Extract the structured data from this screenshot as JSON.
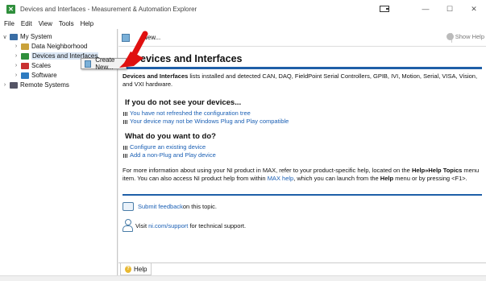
{
  "window": {
    "title": "Devices and Interfaces - Measurement & Automation Explorer",
    "app_icon_glyph": "✕",
    "controls": [
      "restore-icon",
      "minimize",
      "maximize",
      "close"
    ]
  },
  "menubar": [
    "File",
    "Edit",
    "View",
    "Tools",
    "Help"
  ],
  "tree": {
    "items": [
      {
        "label": "My System",
        "chevron": "∨",
        "icon": "computer-icon"
      },
      {
        "label": "Data Neighborhood",
        "chevron": "›",
        "icon": "data-neighborhood-icon"
      },
      {
        "label": "Devices and Interfaces",
        "chevron": "›",
        "icon": "devices-icon"
      },
      {
        "label": "Scales",
        "chevron": "›",
        "icon": "scales-icon"
      },
      {
        "label": "Software",
        "chevron": "›",
        "icon": "software-icon"
      },
      {
        "label": "Remote Systems",
        "chevron": "›",
        "icon": "remote-systems-icon"
      }
    ]
  },
  "context_menu": {
    "label": "Create New..."
  },
  "toolbar": {
    "new_label": "New...",
    "show_help_label": "Show Help"
  },
  "content": {
    "heading": "Devices and Interfaces",
    "intro_bold": "Devices and Interfaces",
    "intro_rest": " lists installed and detected CAN, DAQ, FieldPoint Serial Controllers, GPIB, IVI, Motion, Serial, VISA, Vision, and VXI hardware.",
    "section1_title": "If you do not see your devices...",
    "section1_links": [
      "You have not refreshed the configuration tree",
      "Your device may not be Windows Plug and Play compatible"
    ],
    "section2_title": "What do you want to do?",
    "section2_links": [
      "Configure an existing device",
      "Add a non-Plug and Play device"
    ],
    "info_1": "For more information about using your NI product in MAX, refer to your product-specific help, located on the ",
    "info_bold_1": "Help»Help Topics",
    "info_2": " menu item. You can also access NI product help from within ",
    "info_link": "MAX help",
    "info_3": ", which you can launch from the ",
    "info_bold_2": "Help",
    "info_4": " menu or by pressing <F1>.",
    "feedback_link": "Submit feedback",
    "feedback_rest": " on this topic.",
    "support_prefix": "Visit ",
    "support_link": "ni.com/support",
    "support_rest": " for technical support."
  },
  "help_tab": {
    "label": "Help"
  }
}
